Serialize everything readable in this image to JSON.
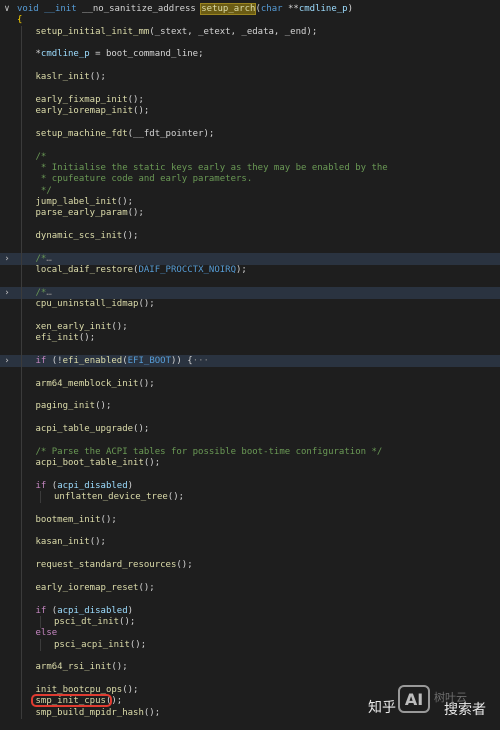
{
  "editor": {
    "theme_colors": {
      "background": "#1e1e1e",
      "keyword": "#569cd6",
      "function": "#dcdcaa",
      "variable": "#9cdcfe",
      "comment": "#6a9955",
      "control": "#c586c0",
      "highlight_box": "#e03c31"
    },
    "lines": [
      {
        "fold": "chevron-down-icon",
        "indent": 0,
        "tokens": [
          [
            "keyword",
            "void"
          ],
          [
            "plain",
            " "
          ],
          [
            "macro",
            "__init"
          ],
          [
            "plain",
            " __no_sanitize_address "
          ],
          [
            "match",
            "setup_arch"
          ],
          [
            "plain",
            "("
          ],
          [
            "type",
            "char"
          ],
          [
            "plain",
            " **"
          ],
          [
            "var",
            "cmdline_p"
          ],
          [
            "plain",
            ")"
          ]
        ]
      },
      {
        "indent": 0,
        "tokens": [
          [
            "brace",
            "{"
          ]
        ]
      },
      {
        "indent": 1,
        "tokens": [
          [
            "func",
            "setup_initial_init_mm"
          ],
          [
            "plain",
            "(_stext, _etext, _edata, _end);"
          ]
        ]
      },
      {
        "indent": 1,
        "tokens": []
      },
      {
        "indent": 1,
        "tokens": [
          [
            "plain",
            "*"
          ],
          [
            "var",
            "cmdline_p"
          ],
          [
            "plain",
            " = boot_command_line;"
          ]
        ]
      },
      {
        "indent": 1,
        "tokens": []
      },
      {
        "indent": 1,
        "tokens": [
          [
            "func",
            "kaslr_init"
          ],
          [
            "plain",
            "();"
          ]
        ]
      },
      {
        "indent": 1,
        "tokens": []
      },
      {
        "indent": 1,
        "tokens": [
          [
            "func",
            "early_fixmap_init"
          ],
          [
            "plain",
            "();"
          ]
        ]
      },
      {
        "indent": 1,
        "tokens": [
          [
            "func",
            "early_ioremap_init"
          ],
          [
            "plain",
            "();"
          ]
        ]
      },
      {
        "indent": 1,
        "tokens": []
      },
      {
        "indent": 1,
        "tokens": [
          [
            "func",
            "setup_machine_fdt"
          ],
          [
            "plain",
            "(__fdt_pointer);"
          ]
        ]
      },
      {
        "indent": 1,
        "tokens": []
      },
      {
        "indent": 1,
        "tokens": [
          [
            "comment",
            "/*"
          ]
        ]
      },
      {
        "indent": 1,
        "tokens": [
          [
            "comment",
            " * Initialise the static keys early as they may be enabled by the"
          ]
        ]
      },
      {
        "indent": 1,
        "tokens": [
          [
            "comment",
            " * cpufeature code and early parameters."
          ]
        ]
      },
      {
        "indent": 1,
        "tokens": [
          [
            "comment",
            " */"
          ]
        ]
      },
      {
        "indent": 1,
        "tokens": [
          [
            "func",
            "jump_label_init"
          ],
          [
            "plain",
            "();"
          ]
        ]
      },
      {
        "indent": 1,
        "tokens": [
          [
            "func",
            "parse_early_param"
          ],
          [
            "plain",
            "();"
          ]
        ]
      },
      {
        "indent": 1,
        "tokens": []
      },
      {
        "indent": 1,
        "tokens": [
          [
            "func",
            "dynamic_scs_init"
          ],
          [
            "plain",
            "();"
          ]
        ]
      },
      {
        "indent": 1,
        "tokens": []
      },
      {
        "fold": "chevron-right-icon",
        "hl": true,
        "indent": 1,
        "tokens": [
          [
            "comment",
            "/*"
          ],
          [
            "fold",
            "…"
          ]
        ]
      },
      {
        "indent": 1,
        "tokens": [
          [
            "func",
            "local_daif_restore"
          ],
          [
            "plain",
            "("
          ],
          [
            "macro",
            "DAIF_PROCCTX_NOIRQ"
          ],
          [
            "plain",
            ");"
          ]
        ]
      },
      {
        "indent": 1,
        "tokens": []
      },
      {
        "fold": "chevron-right-icon",
        "hl": true,
        "indent": 1,
        "tokens": [
          [
            "comment",
            "/*"
          ],
          [
            "fold",
            "…"
          ]
        ]
      },
      {
        "indent": 1,
        "tokens": [
          [
            "func",
            "cpu_uninstall_idmap"
          ],
          [
            "plain",
            "();"
          ]
        ]
      },
      {
        "indent": 1,
        "tokens": []
      },
      {
        "indent": 1,
        "tokens": [
          [
            "func",
            "xen_early_init"
          ],
          [
            "plain",
            "();"
          ]
        ]
      },
      {
        "indent": 1,
        "tokens": [
          [
            "func",
            "efi_init"
          ],
          [
            "plain",
            "();"
          ]
        ]
      },
      {
        "indent": 1,
        "tokens": []
      },
      {
        "fold": "chevron-right-icon",
        "hl": true,
        "indent": 1,
        "tokens": [
          [
            "ctrl",
            "if"
          ],
          [
            "plain",
            " (!"
          ],
          [
            "func",
            "efi_enabled"
          ],
          [
            "plain",
            "("
          ],
          [
            "macro",
            "EFI_BOOT"
          ],
          [
            "plain",
            ")) {"
          ],
          [
            "fold",
            "···"
          ]
        ]
      },
      {
        "indent": 1,
        "tokens": []
      },
      {
        "indent": 1,
        "tokens": [
          [
            "func",
            "arm64_memblock_init"
          ],
          [
            "plain",
            "();"
          ]
        ]
      },
      {
        "indent": 1,
        "tokens": []
      },
      {
        "indent": 1,
        "tokens": [
          [
            "func",
            "paging_init"
          ],
          [
            "plain",
            "();"
          ]
        ]
      },
      {
        "indent": 1,
        "tokens": []
      },
      {
        "indent": 1,
        "tokens": [
          [
            "func",
            "acpi_table_upgrade"
          ],
          [
            "plain",
            "();"
          ]
        ]
      },
      {
        "indent": 1,
        "tokens": []
      },
      {
        "indent": 1,
        "tokens": [
          [
            "comment",
            "/* Parse the ACPI tables for possible boot-time configuration */"
          ]
        ]
      },
      {
        "indent": 1,
        "tokens": [
          [
            "func",
            "acpi_boot_table_init"
          ],
          [
            "plain",
            "();"
          ]
        ]
      },
      {
        "indent": 1,
        "tokens": []
      },
      {
        "indent": 1,
        "tokens": [
          [
            "ctrl",
            "if"
          ],
          [
            "plain",
            " ("
          ],
          [
            "var",
            "acpi_disabled"
          ],
          [
            "plain",
            ")"
          ]
        ]
      },
      {
        "indent": 2,
        "tokens": [
          [
            "func",
            "unflatten_device_tree"
          ],
          [
            "plain",
            "();"
          ]
        ]
      },
      {
        "indent": 1,
        "tokens": []
      },
      {
        "indent": 1,
        "tokens": [
          [
            "func",
            "bootmem_init"
          ],
          [
            "plain",
            "();"
          ]
        ]
      },
      {
        "indent": 1,
        "tokens": []
      },
      {
        "indent": 1,
        "tokens": [
          [
            "func",
            "kasan_init"
          ],
          [
            "plain",
            "();"
          ]
        ]
      },
      {
        "indent": 1,
        "tokens": []
      },
      {
        "indent": 1,
        "tokens": [
          [
            "func",
            "request_standard_resources"
          ],
          [
            "plain",
            "();"
          ]
        ]
      },
      {
        "indent": 1,
        "tokens": []
      },
      {
        "indent": 1,
        "tokens": [
          [
            "func",
            "early_ioremap_reset"
          ],
          [
            "plain",
            "();"
          ]
        ]
      },
      {
        "indent": 1,
        "tokens": []
      },
      {
        "indent": 1,
        "tokens": [
          [
            "ctrl",
            "if"
          ],
          [
            "plain",
            " ("
          ],
          [
            "var",
            "acpi_disabled"
          ],
          [
            "plain",
            ")"
          ]
        ]
      },
      {
        "indent": 2,
        "tokens": [
          [
            "func",
            "psci_dt_init"
          ],
          [
            "plain",
            "();"
          ]
        ]
      },
      {
        "indent": 1,
        "tokens": [
          [
            "ctrl",
            "else"
          ]
        ]
      },
      {
        "indent": 2,
        "tokens": [
          [
            "func",
            "psci_acpi_init"
          ],
          [
            "plain",
            "();"
          ]
        ]
      },
      {
        "indent": 1,
        "tokens": []
      },
      {
        "indent": 1,
        "tokens": [
          [
            "func",
            "arm64_rsi_init"
          ],
          [
            "plain",
            "();"
          ]
        ]
      },
      {
        "indent": 1,
        "tokens": []
      },
      {
        "indent": 1,
        "tokens": [
          [
            "func",
            "init_bootcpu_ops"
          ],
          [
            "plain",
            "();"
          ]
        ]
      },
      {
        "indent": 1,
        "tokens": [
          [
            "func",
            "smp_init_cpus"
          ],
          [
            "plain",
            "();"
          ]
        ]
      },
      {
        "indent": 1,
        "tokens": [
          [
            "func",
            "smp_build_mpidr_hash"
          ],
          [
            "plain",
            "();"
          ]
        ]
      }
    ]
  },
  "watermark": {
    "left_text": "知乎",
    "logo_text": "AI",
    "right_top_text": "树叶云",
    "right_text": "搜索者"
  }
}
